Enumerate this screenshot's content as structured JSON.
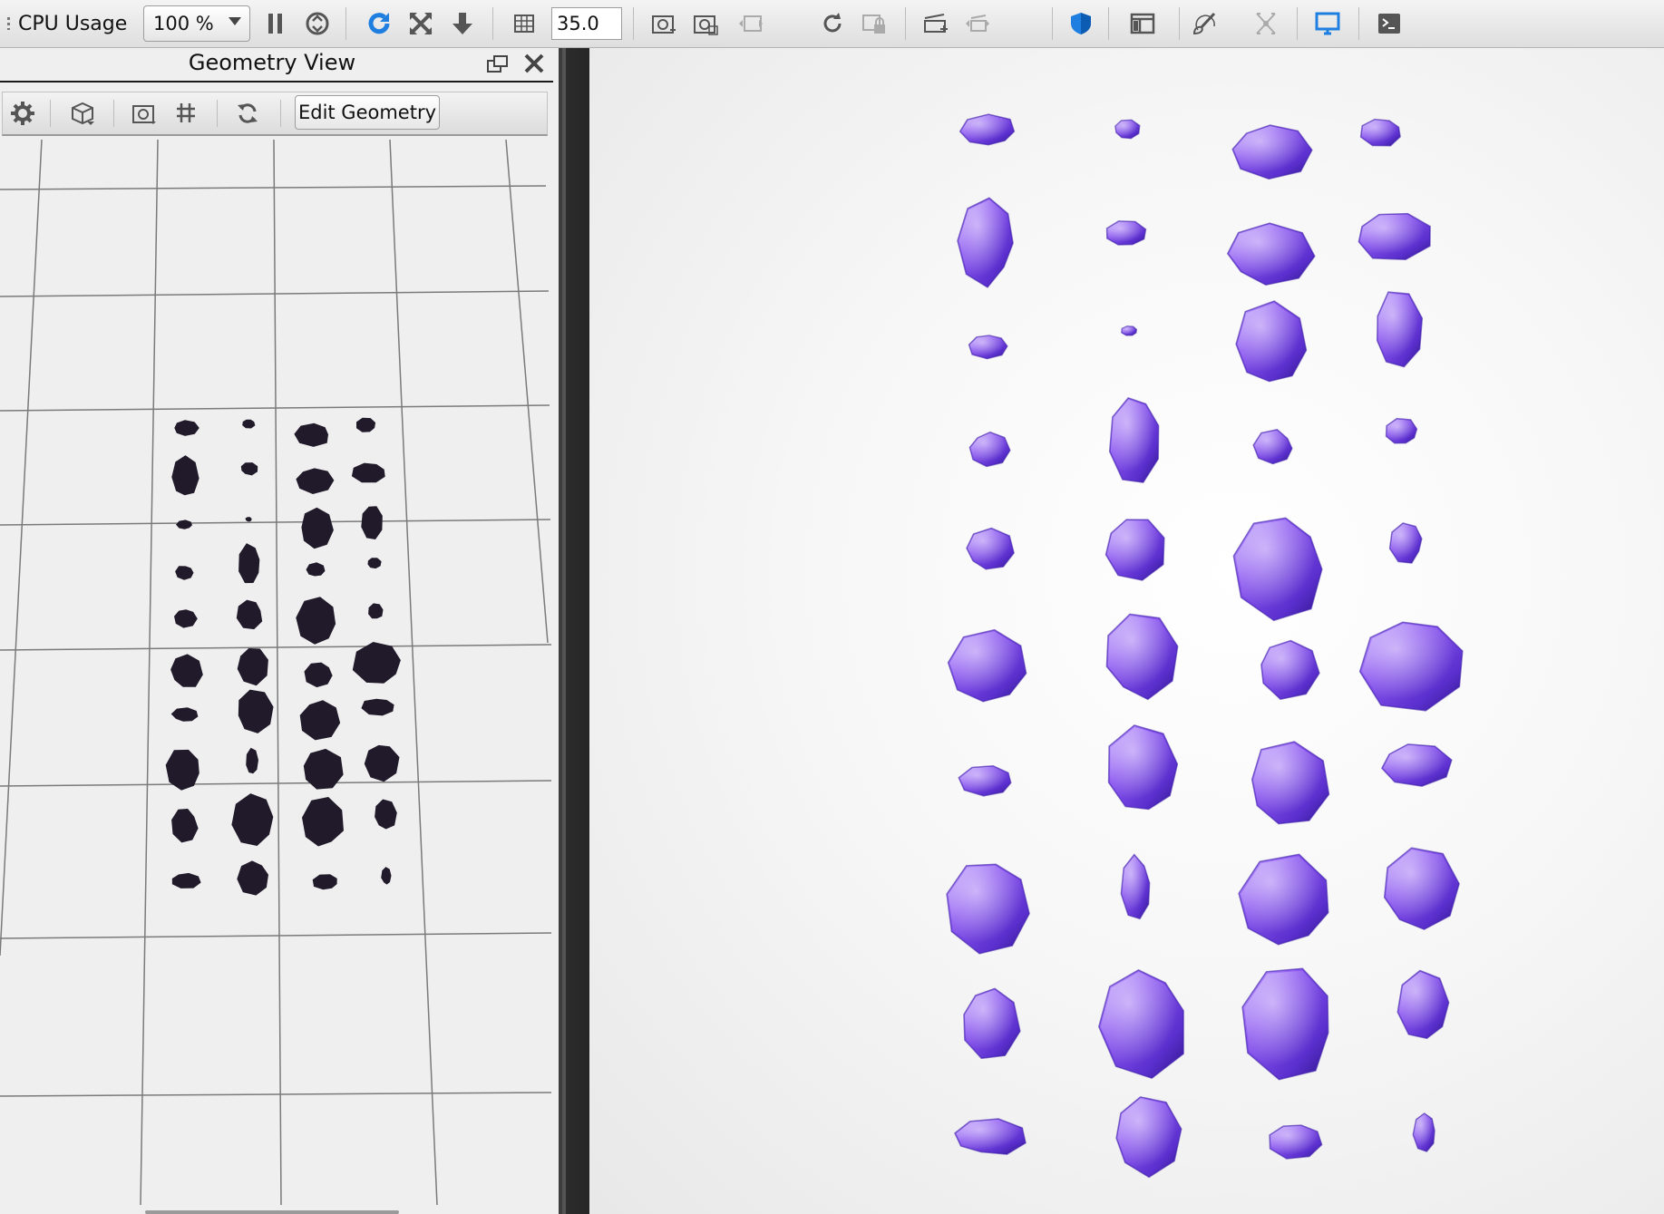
{
  "toolbar": {
    "cpu_label": "CPU Usage",
    "zoom_value": "100 %",
    "fov_value": "35.0",
    "icons": [
      "pause-icon",
      "denoise-icon",
      "restart-render-icon",
      "fit-view-icon",
      "drop-to-ground-icon",
      "field-of-view-icon",
      "screenshot-icon",
      "screenshot-region-icon",
      "previous-screenshot-icon",
      "refresh-screenshot-icon",
      "lock-screenshot-icon",
      "add-camera-icon",
      "previous-camera-icon",
      "region-render-icon",
      "panels-icon",
      "paint-icon",
      "mesh-icon",
      "monitor-icon",
      "terminal-icon"
    ],
    "accent_blue": "#1e7fe0"
  },
  "geometry_view": {
    "title": "Geometry View",
    "edit_button_label": "Edit Geometry",
    "icons": [
      "settings-icon",
      "cube-view-icon",
      "screenshot-icon",
      "grid-icon",
      "refresh-icon",
      "float-window-icon",
      "close-icon"
    ]
  },
  "render_view": {
    "stone_color": "#7a45e0",
    "stone_dark": "#3c1ca8"
  }
}
